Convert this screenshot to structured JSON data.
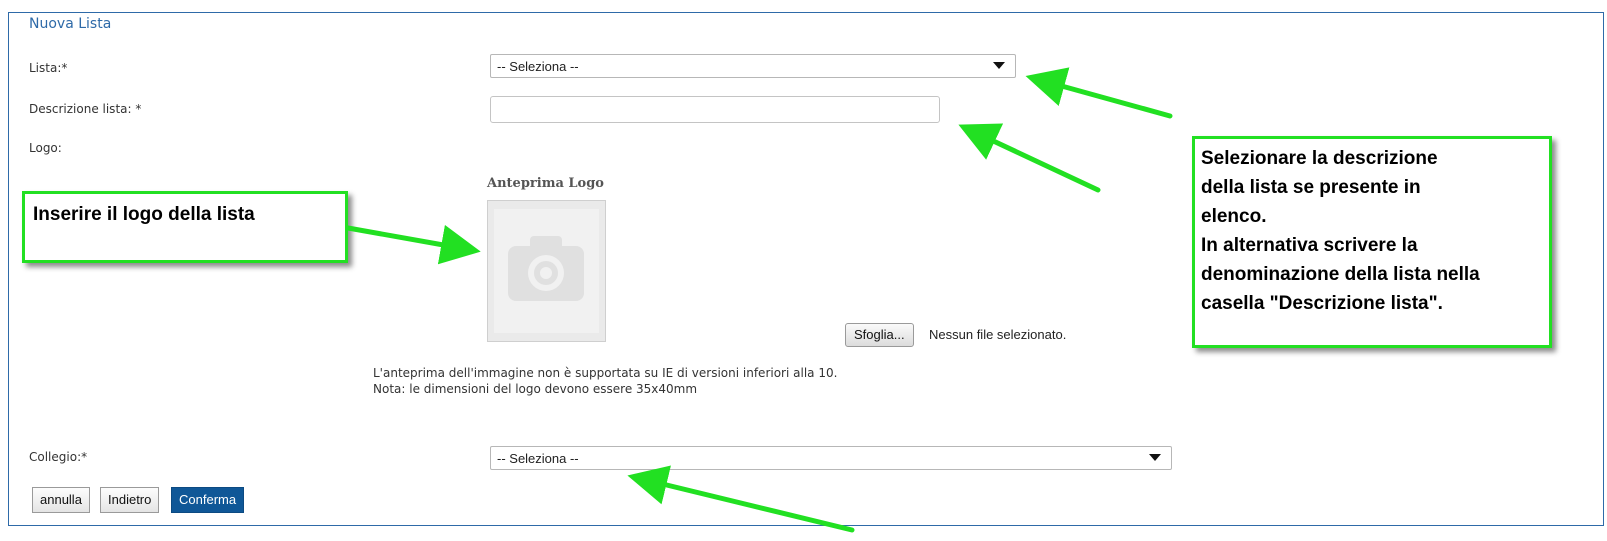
{
  "form": {
    "legend": "Nuova Lista",
    "lista_label": "Lista:*",
    "lista_select": "-- Seleziona --",
    "descrizione_label": "Descrizione lista: *",
    "descrizione_value": "",
    "logo_label": "Logo:",
    "preview_title": "Anteprima Logo",
    "file_button": "Sfoglia...",
    "file_status": "Nessun file selezionato.",
    "note_line1": "L'anteprima dell'immagine non è supportata su IE di versioni inferiori alla 10.",
    "note_line2": "Nota: le dimensioni del logo devono essere 35x40mm",
    "collegio_label": "Collegio:*",
    "collegio_select": "-- Seleziona --"
  },
  "buttons": {
    "annulla": "annulla",
    "indietro": "Indietro",
    "conferma": "Conferma"
  },
  "callouts": {
    "logo": "Inserire il logo della lista",
    "descrizione": "Selezionare la descrizione\ndella lista se presente in\nelenco.\nIn alternativa scrivere la\ndenominazione della lista nella\ncasella \"Descrizione lista\"."
  },
  "colors": {
    "fieldset_border": "#2e6aa8",
    "primary_button": "#0f5797",
    "callout_border": "#22e022",
    "arrow": "#22e022"
  },
  "icons": {
    "preview": "camera-icon",
    "select_caret": "caret-down-icon"
  }
}
